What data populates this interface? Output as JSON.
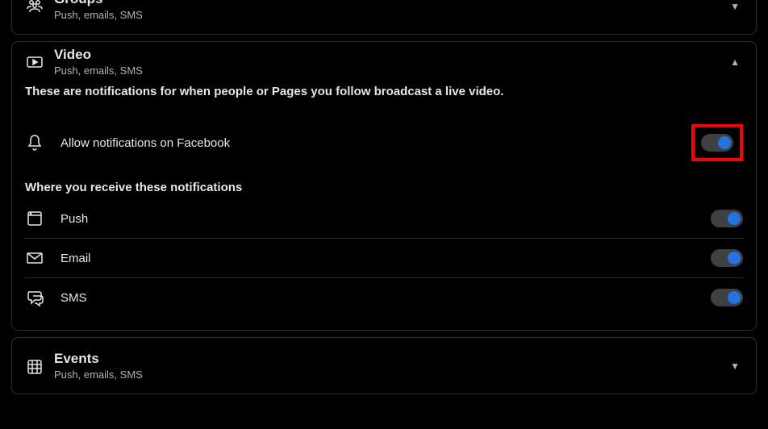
{
  "sections": {
    "groups": {
      "title": "Groups",
      "subtitle": "Push, emails, SMS"
    },
    "video": {
      "title": "Video",
      "subtitle": "Push, emails, SMS",
      "description": "These are notifications for when people or Pages you follow broadcast a live video.",
      "allow_label": "Allow notifications on Facebook",
      "where_label": "Where you receive these notifications",
      "channels": {
        "push": "Push",
        "email": "Email",
        "sms": "SMS"
      }
    },
    "events": {
      "title": "Events",
      "subtitle": "Push, emails, SMS"
    }
  }
}
